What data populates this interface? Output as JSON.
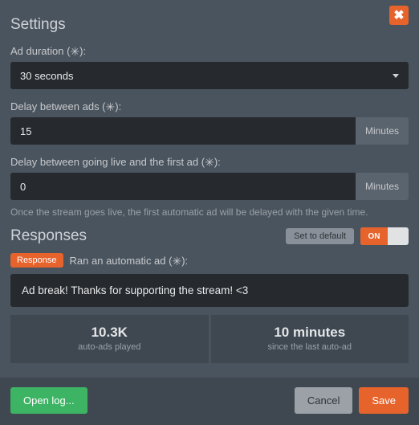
{
  "close_icon": "✖",
  "settings": {
    "title": "Settings",
    "ad_duration": {
      "label_pre": "Ad duration (",
      "label_post": "):",
      "asterisk": "✳",
      "value": "30 seconds"
    },
    "delay_between_ads": {
      "label_pre": "Delay between ads (",
      "label_post": "):",
      "asterisk": "✳",
      "value": "15",
      "unit": "Minutes"
    },
    "delay_first_ad": {
      "label_pre": "Delay between going live and the first ad (",
      "label_post": "):",
      "asterisk": "✳",
      "value": "0",
      "unit": "Minutes",
      "helper": "Once the stream goes live, the first automatic ad will be delayed with the given time."
    }
  },
  "responses": {
    "title": "Responses",
    "set_default": "Set to default",
    "toggle_on": "ON",
    "badge": "Response",
    "label_pre": "Ran an automatic ad (",
    "label_post": "):",
    "asterisk": "✳",
    "message": "Ad break! Thanks for supporting the stream! <3"
  },
  "stats": [
    {
      "value": "10.3K",
      "label": "auto-ads played"
    },
    {
      "value": "10 minutes",
      "label": "since the last auto-ad"
    }
  ],
  "footer": {
    "open_log": "Open log...",
    "cancel": "Cancel",
    "save": "Save"
  }
}
